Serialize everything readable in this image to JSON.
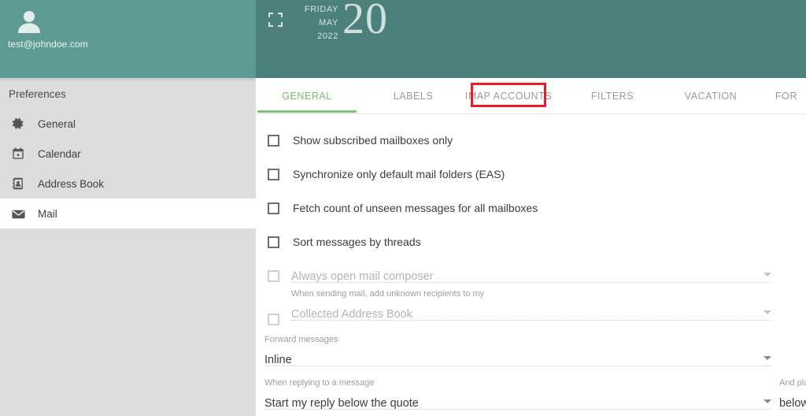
{
  "colors": {
    "account_panel_bg": "#5e9b95",
    "date_header_bg": "#4c807c",
    "sidebar_bg": "#dddddd",
    "active_tab_green": "#74c06d",
    "highlight_red": "#ed1c24"
  },
  "account": {
    "avatar_icon": "user-avatar-icon",
    "email": "test@johndoe.com"
  },
  "sidebar": {
    "title": "Preferences",
    "items": [
      {
        "label": "General",
        "icon": "gear-icon",
        "active": false
      },
      {
        "label": "Calendar",
        "icon": "calendar-icon",
        "active": false
      },
      {
        "label": "Address Book",
        "icon": "address-book-icon",
        "active": false
      },
      {
        "label": "Mail",
        "icon": "envelope-icon",
        "active": true
      }
    ]
  },
  "date_header": {
    "fullscreen_icon": "fullscreen-icon",
    "weekday": "FRIDAY",
    "month": "MAY",
    "year": "2022",
    "day": "20"
  },
  "tabs": [
    {
      "label": "GENERAL",
      "active": true,
      "highlighted": false
    },
    {
      "label": "LABELS",
      "active": false,
      "highlighted": false
    },
    {
      "label": "IMAP ACCOUNTS",
      "active": false,
      "highlighted": true
    },
    {
      "label": "FILTERS",
      "active": false,
      "highlighted": false
    },
    {
      "label": "VACATION",
      "active": false,
      "highlighted": false
    },
    {
      "label": "FOR",
      "active": false,
      "highlighted": false
    }
  ],
  "settings": {
    "checkboxes": [
      {
        "label": "Show subscribed mailboxes only",
        "checked": false
      },
      {
        "label": "Synchronize only default mail folders (EAS)",
        "checked": false
      },
      {
        "label": "Fetch count of unseen messages for all mailboxes",
        "checked": false
      },
      {
        "label": "Sort messages by threads",
        "checked": false
      }
    ],
    "fields": [
      {
        "caption": "",
        "value": "Always open mail composer",
        "disabled": true,
        "has_checkbox": true
      },
      {
        "caption": "When sending mail, add unknown recipients to my",
        "value": "Collected Address Book",
        "disabled": true,
        "has_checkbox": true
      },
      {
        "caption": "Forward messages",
        "value": "Inline",
        "disabled": false,
        "has_checkbox": false
      },
      {
        "caption": "When replying to a message",
        "value": "Start my reply below the quote",
        "disabled": false,
        "has_checkbox": false
      }
    ],
    "clipped_field": {
      "caption": "And plac",
      "value": "below"
    }
  }
}
